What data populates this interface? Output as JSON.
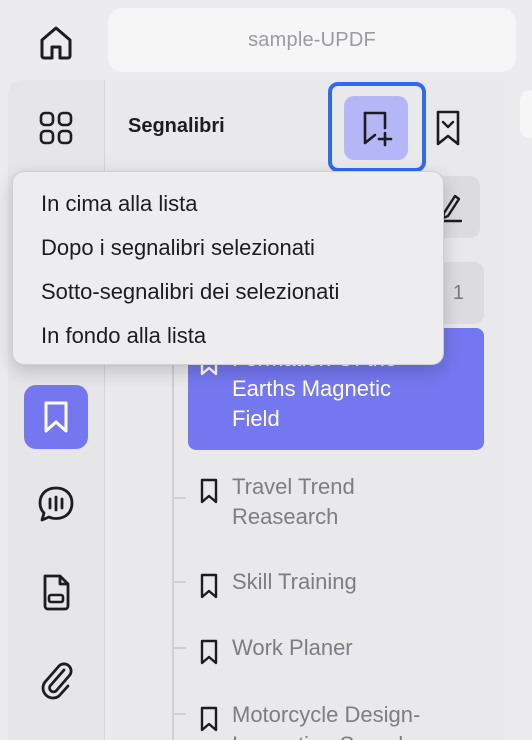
{
  "header": {
    "document_title": "sample-UPDF"
  },
  "sidebar": {
    "items": [
      {
        "name": "thumbnails-icon",
        "active": false
      },
      {
        "name": "bookmark-icon",
        "active": true
      },
      {
        "name": "comments-icon",
        "active": false
      },
      {
        "name": "attachment-file-icon",
        "active": false
      },
      {
        "name": "paperclip-icon",
        "active": false
      }
    ]
  },
  "panel": {
    "title": "Segnalibri",
    "count": "1"
  },
  "bookmarks": [
    {
      "label_line1": "Formation Of the",
      "label_line2": "Earths Magnetic",
      "label_line3": "Field",
      "selected": true
    },
    {
      "label_line1": "Travel Trend",
      "label_line2": "Reasearch",
      "selected": false
    },
    {
      "label_line1": "Skill Training",
      "selected": false
    },
    {
      "label_line1": "Work Planer",
      "selected": false
    },
    {
      "label_line1": "Motorcycle Design-",
      "label_line2": "Innovating Speed",
      "selected": false
    }
  ],
  "menu": {
    "items": [
      "In cima alla lista",
      "Dopo i segnalibri selezionati",
      "Sotto-segnalibri dei selezionati",
      "In fondo alla lista"
    ]
  },
  "colors": {
    "accent": "#7477ef",
    "focus_ring": "#2f6bf2",
    "add_button_bg": "#b4b6f8"
  }
}
